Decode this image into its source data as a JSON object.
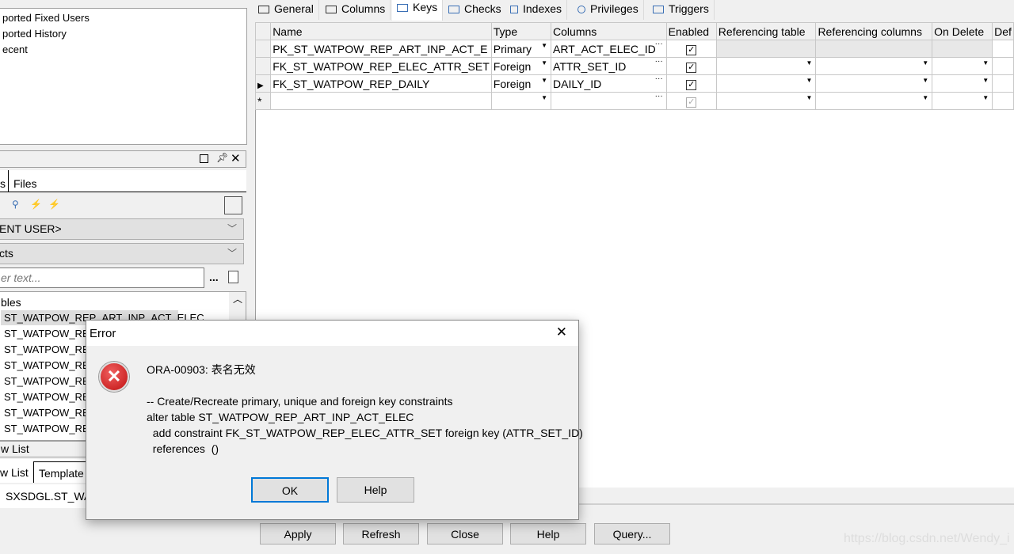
{
  "left": {
    "top_list": [
      "ported Fixed Users",
      "ported History",
      "ecent"
    ],
    "panel_tabs": [
      "s",
      "Files"
    ],
    "user_combo": "ENT USER>",
    "type_combo": "cts",
    "filter_placeholder": "er text...",
    "filter_more": "...",
    "tree_root": "bles",
    "tree_items": [
      "ST_WATPOW_REP_ART_INP_ACT_ELEC",
      "ST_WATPOW_REP_",
      "ST_WATPOW_REP_",
      "ST_WATPOW_REP_",
      "ST_WATPOW_REP_",
      "ST_WATPOW_REP_",
      "ST_WATPOW_REP_",
      "ST_WATPOW_REP_"
    ],
    "section_title": "w List",
    "bottom_tabs": [
      "w List",
      "Template"
    ],
    "bottom_text": "SXSDGL.ST_WA"
  },
  "tabs": [
    "General",
    "Columns",
    "Keys",
    "Checks",
    "Indexes",
    "Privileges",
    "Triggers"
  ],
  "active_tab": "Keys",
  "grid": {
    "headers": [
      "Name",
      "Type",
      "Columns",
      "Enabled",
      "Referencing table",
      "Referencing columns",
      "On Delete",
      "Def"
    ],
    "rows": [
      {
        "name": "PK_ST_WATPOW_REP_ART_INP_ACT_E",
        "type": "Primary",
        "columns": "ART_ACT_ELEC_ID",
        "enabled": true
      },
      {
        "name": "FK_ST_WATPOW_REP_ELEC_ATTR_SET",
        "type": "Foreign",
        "columns": "ATTR_SET_ID",
        "enabled": true
      },
      {
        "name": "FK_ST_WATPOW_REP_DAILY",
        "type": "Foreign",
        "columns": "DAILY_ID",
        "enabled": true
      }
    ]
  },
  "buttons": [
    "Apply",
    "Refresh",
    "Close",
    "Help",
    "Query..."
  ],
  "dialog": {
    "title": "Error",
    "message": "ORA-00903: 表名无效\n\n-- Create/Recreate primary, unique and foreign key constraints\nalter table ST_WATPOW_REP_ART_INP_ACT_ELEC\n  add constraint FK_ST_WATPOW_REP_ELEC_ATTR_SET foreign key (ATTR_SET_ID)\n  references  ()",
    "ok": "OK",
    "help": "Help",
    "icon": "error-icon"
  },
  "watermark": "https://blog.csdn.net/Wendy_i"
}
